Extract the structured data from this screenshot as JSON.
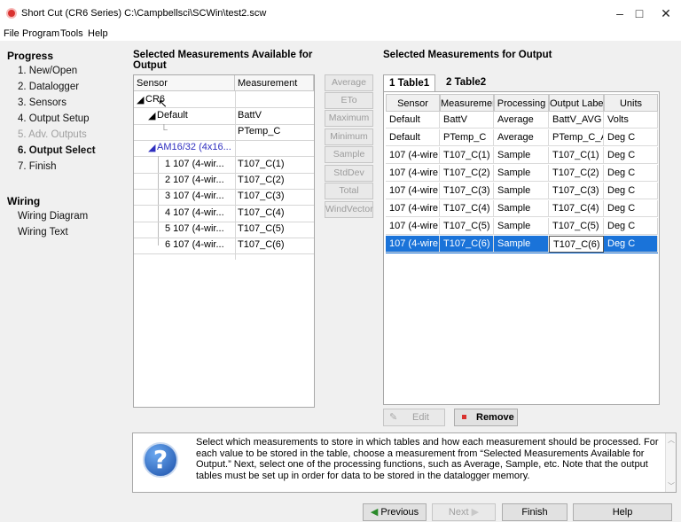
{
  "window": {
    "title": "Short Cut (CR6 Series) C:\\Campbellsci\\SCWin\\test2.scw",
    "minimize": "–",
    "maximize": "□",
    "close": "✕"
  },
  "menu": [
    "File",
    "Program",
    "Tools",
    "Help"
  ],
  "progress": {
    "title": "Progress",
    "steps": [
      "1. New/Open",
      "2. Datalogger",
      "3. Sensors",
      "4. Output Setup",
      "5. Adv. Outputs",
      "6. Output Select",
      "7. Finish"
    ]
  },
  "wiring": {
    "title": "Wiring",
    "items": [
      "Wiring Diagram",
      "Wiring Text"
    ]
  },
  "available": {
    "title": "Selected Measurements Available for Output",
    "headers": [
      "Sensor",
      "Measurement"
    ],
    "rows": [
      {
        "sensor": "CR6",
        "meas": ""
      },
      {
        "sensor": "Default",
        "meas": "BattV"
      },
      {
        "sensor": "",
        "meas": "PTemp_C"
      },
      {
        "sensor": "AM16/32 (4x16...",
        "meas": ""
      },
      {
        "sensor": "1 107 (4-wir...",
        "meas": "T107_C(1)"
      },
      {
        "sensor": "2 107 (4-wir...",
        "meas": "T107_C(2)"
      },
      {
        "sensor": "3 107 (4-wir...",
        "meas": "T107_C(3)"
      },
      {
        "sensor": "4 107 (4-wir...",
        "meas": "T107_C(4)"
      },
      {
        "sensor": "5 107 (4-wir...",
        "meas": "T107_C(5)"
      },
      {
        "sensor": "6 107 (4-wir...",
        "meas": "T107_C(6)"
      }
    ]
  },
  "functions": [
    "Average",
    "ETo",
    "Maximum",
    "Minimum",
    "Sample",
    "StdDev",
    "Total",
    "WindVector"
  ],
  "output": {
    "title": "Selected Measurements for Output",
    "tabs": [
      "1 Table1",
      "2 Table2"
    ],
    "headers": [
      "Sensor",
      "Measuremer",
      "Processing",
      "Output Labe",
      "Units"
    ],
    "rows": [
      [
        "Default",
        "BattV",
        "Average",
        "BattV_AVG",
        "Volts"
      ],
      [
        "Default",
        "PTemp_C",
        "Average",
        "PTemp_C_A",
        "Deg C"
      ],
      [
        "107 (4-wire",
        "T107_C(1)",
        "Sample",
        "T107_C(1)",
        "Deg C"
      ],
      [
        "107 (4-wire",
        "T107_C(2)",
        "Sample",
        "T107_C(2)",
        "Deg C"
      ],
      [
        "107 (4-wire",
        "T107_C(3)",
        "Sample",
        "T107_C(3)",
        "Deg C"
      ],
      [
        "107 (4-wire",
        "T107_C(4)",
        "Sample",
        "T107_C(4)",
        "Deg C"
      ],
      [
        "107 (4-wire",
        "T107_C(5)",
        "Sample",
        "T107_C(5)",
        "Deg C"
      ],
      [
        "107 (4-wire",
        "T107_C(6)",
        "Sample",
        "T107_C(6)",
        "Deg C"
      ]
    ],
    "selected_row": 7
  },
  "actions": {
    "edit": "Edit",
    "remove": "Remove"
  },
  "help_text": "Select which measurements to store in which tables and how each measurement should be processed. For each value to be stored in the table, choose a measurement from “Selected Measurements Available for Output.”  Next, select one of the processing functions, such as Average, Sample, etc. Note that the output tables must be set up in order for data to be stored in the datalogger memory.",
  "nav": {
    "previous": "Previous",
    "next": "Next",
    "finish": "Finish",
    "help": "Help"
  },
  "colors": {
    "selection": "#1a73d9",
    "link": "#2f2fbf",
    "disabled": "#a0a0a0"
  }
}
